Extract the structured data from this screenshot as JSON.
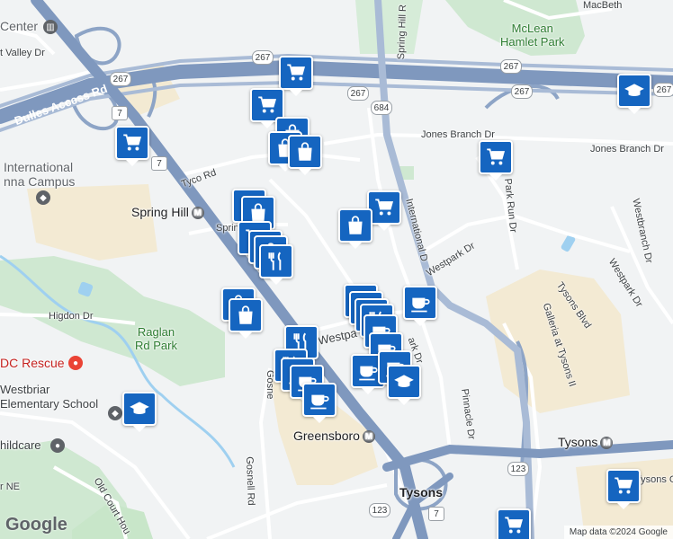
{
  "map": {
    "labels": {
      "center": "Center",
      "valley_dr": "t Valley Dr",
      "dulles_access": "Dulles Access Rd",
      "international": "International",
      "anna_campus": "nna Campus",
      "tyco": "Tyco Rd",
      "spring_hill": "Spring Hill",
      "spring_road": "Spring",
      "higdon": "Higdon Dr",
      "raglan_park": "Raglan\nRd Park",
      "dc_rescue": "DC Rescue",
      "westbriar": "Westbriar\nElementary School",
      "childcare": "hildcare",
      "old_court": "Old Court Hou",
      "ne": "r NE",
      "gosnell_rd": "Gosnell Rd",
      "gosnell_side": "Gosne",
      "greensboro": "Greensboro",
      "tysons_center": "Tysons",
      "tysons_metro": "Tysons",
      "tysons_right": "Tysons Ga",
      "spring_hill_rd": "Spring Hill R",
      "mclean_park": "McLean\nHamlet Park",
      "macbeth": "MacBeth",
      "jones_branch_1": "Jones Branch Dr",
      "jones_branch_2": "Jones Branch Dr",
      "intl_dr": "International D",
      "westpark_dr_1": "Westpark Dr",
      "westpark_dr_2": "Westpark Dr",
      "westbranch": "Westbranch Dr",
      "park_run": "Park Run Dr",
      "tysons_blvd": "Tysons Blvd",
      "galleria": "Galleria at Tysons II",
      "pinnacle": "Pinnacle Dr",
      "westpark_bottom": "Westpa",
      "park_dr": "ark Dr"
    },
    "shields": [
      "267",
      "267",
      "267",
      "267",
      "267",
      "684",
      "7",
      "7",
      "123",
      "123",
      "7"
    ],
    "google": "Google",
    "attribution": "Map data ©2024 Google"
  },
  "pins": {
    "shopping_cart": "shopping-cart",
    "shopping_bag": "shopping-bag",
    "restaurant": "restaurant",
    "cafe": "cafe",
    "school": "school"
  },
  "colors": {
    "land": "#f1f3f4",
    "highway": "#8da4c6",
    "park": "#c8e6c9",
    "commercial": "#f3ead3",
    "water": "#9fd0f0",
    "pin": "#1565c0"
  }
}
